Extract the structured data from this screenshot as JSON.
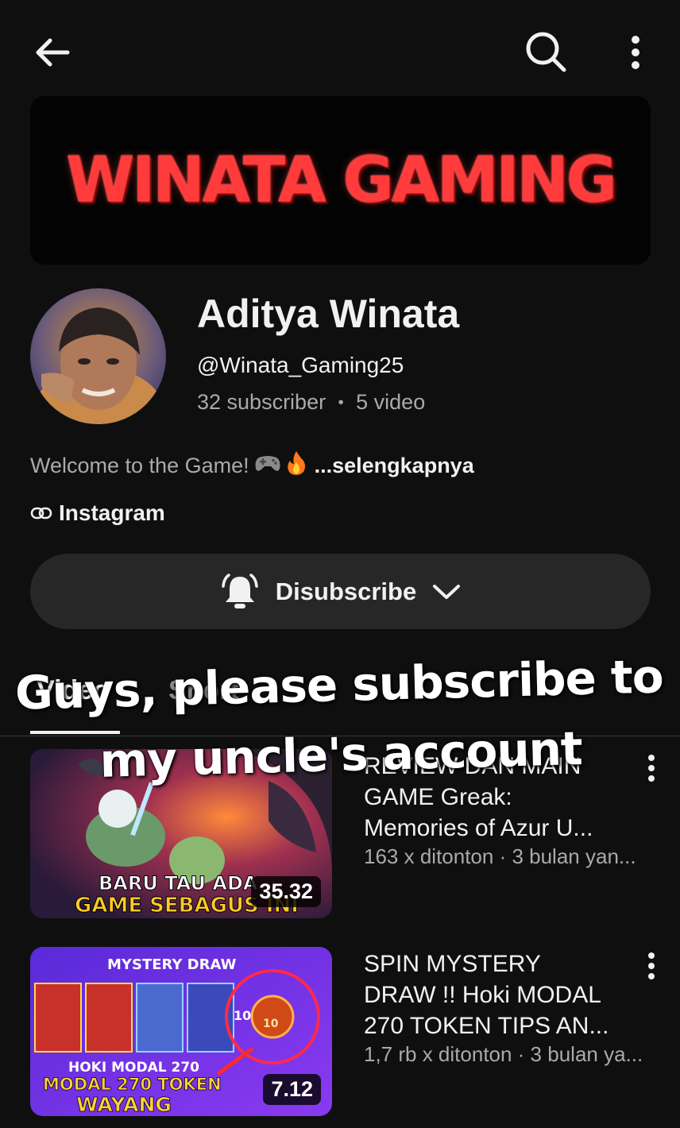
{
  "banner": {
    "text": "WINATA GAMING"
  },
  "channel": {
    "name": "Aditya Winata",
    "handle": "@Winata_Gaming25",
    "subscribers": "32 subscriber",
    "separator": "•",
    "videos": "5 video",
    "description": "Welcome to the Game!",
    "description_more": "...selengkapnya",
    "link_label": "Instagram"
  },
  "subscribe_button": {
    "label": "Disubscribe"
  },
  "tabs": [
    {
      "label": "Video"
    },
    {
      "label": "Short"
    }
  ],
  "overlay_caption": "Guys, please subscribe to my uncle's account",
  "videos": [
    {
      "title_line1": "REVIEW DAN MAIN",
      "title_line2": "GAME Greak:",
      "title_line3": "Memories of Azur U...",
      "meta": "163 x ditonton · 3 bulan yan...",
      "duration": "35.32",
      "thumb_text1": "BARU TAU ADA",
      "thumb_text2": "GAME SEBAGUS INI"
    },
    {
      "title_line1": "SPIN MYSTERY",
      "title_line2": "DRAW !!  Hoki MODAL",
      "title_line3": "270 TOKEN TIPS AN...",
      "meta": "1,7 rb x ditonton · 3 bulan ya...",
      "duration": "7.12",
      "thumb_text1": "MYSTERY DRAW",
      "thumb_text2": "HOKI MODAL 270",
      "thumb_text3": "MODAL 270 TOKEN",
      "thumb_text4": "WAYANG",
      "thumb_text5": "10",
      "thumb_text6": "10"
    }
  ],
  "colors": {
    "background": "#0f0f0f",
    "banner_text": "#ff3b3b",
    "button_bg": "#272727",
    "secondary_text": "#aaaaaa"
  }
}
